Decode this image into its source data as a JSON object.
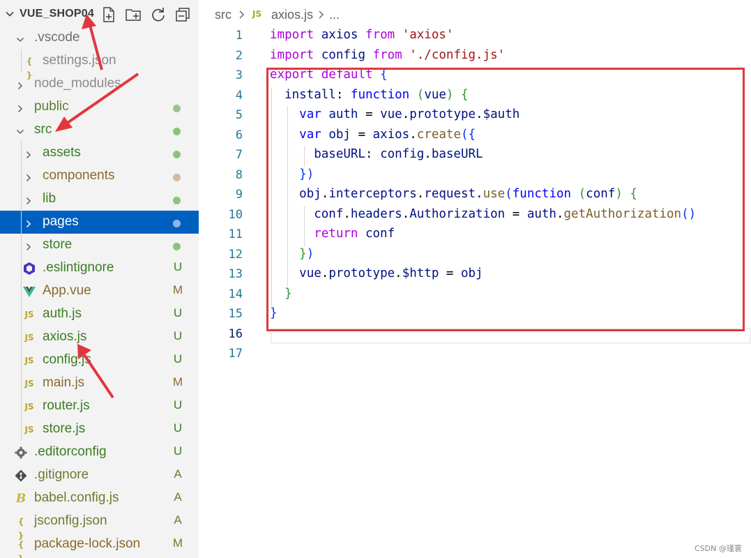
{
  "explorer": {
    "folder_name": "VUE_SHOP04",
    "actions": [
      "new-file-icon",
      "new-folder-icon",
      "refresh-icon",
      "collapse-all-icon"
    ],
    "items": [
      {
        "label": ".vscode",
        "kind": "folder",
        "expanded": true,
        "depth": 1,
        "color": "#6f6f6f",
        "status": "",
        "dot": ""
      },
      {
        "label": "settings.json",
        "kind": "json",
        "depth": 2,
        "color": "#8a8a8a",
        "status": "",
        "dot": ""
      },
      {
        "label": "node_modules",
        "kind": "folder",
        "expanded": false,
        "depth": 1,
        "color": "#8a8a8a",
        "status": "",
        "dot": ""
      },
      {
        "label": "public",
        "kind": "folder",
        "expanded": false,
        "depth": 1,
        "color": "#5a7f2c",
        "status": "",
        "dot": "#9cc38e"
      },
      {
        "label": "src",
        "kind": "folder",
        "expanded": true,
        "depth": 1,
        "color": "#3a7d22",
        "status": "",
        "dot": "#8cc27e"
      },
      {
        "label": "assets",
        "kind": "folder",
        "expanded": false,
        "depth": 2,
        "color": "#3a7d22",
        "status": "",
        "dot": "#8cc27e"
      },
      {
        "label": "components",
        "kind": "folder",
        "expanded": false,
        "depth": 2,
        "color": "#8a6a2c",
        "status": "",
        "dot": "#d5b99a"
      },
      {
        "label": "lib",
        "kind": "folder",
        "expanded": false,
        "depth": 2,
        "color": "#3a7d22",
        "status": "",
        "dot": "#8cc27e"
      },
      {
        "label": "pages",
        "kind": "folder",
        "expanded": false,
        "depth": 2,
        "color": "#ffffff",
        "status": "",
        "dot": "#8fb6e8",
        "selected": true
      },
      {
        "label": "store",
        "kind": "folder",
        "expanded": false,
        "depth": 2,
        "color": "#3a7d22",
        "status": "",
        "dot": "#8cc27e"
      },
      {
        "label": ".eslintignore",
        "kind": "eslint",
        "depth": 2,
        "color": "#3a7d22",
        "status": "U"
      },
      {
        "label": "App.vue",
        "kind": "vue",
        "depth": 2,
        "color": "#8a6a2c",
        "status": "M"
      },
      {
        "label": "auth.js",
        "kind": "js",
        "depth": 2,
        "color": "#3a7d22",
        "status": "U"
      },
      {
        "label": "axios.js",
        "kind": "js",
        "depth": 2,
        "color": "#3a7d22",
        "status": "U"
      },
      {
        "label": "config.js",
        "kind": "js",
        "depth": 2,
        "color": "#3a7d22",
        "status": "U"
      },
      {
        "label": "main.js",
        "kind": "js",
        "depth": 2,
        "color": "#8a6a2c",
        "status": "M"
      },
      {
        "label": "router.js",
        "kind": "js",
        "depth": 2,
        "color": "#3a7d22",
        "status": "U"
      },
      {
        "label": "store.js",
        "kind": "js",
        "depth": 2,
        "color": "#3a7d22",
        "status": "U"
      },
      {
        "label": ".editorconfig",
        "kind": "gear",
        "depth": 1,
        "color": "#3a7d22",
        "status": "U"
      },
      {
        "label": ".gitignore",
        "kind": "git",
        "depth": 1,
        "color": "#6f7a2c",
        "status": "A"
      },
      {
        "label": "babel.config.js",
        "kind": "babel",
        "depth": 1,
        "color": "#6f7a2c",
        "status": "A"
      },
      {
        "label": "jsconfig.json",
        "kind": "json",
        "depth": 1,
        "color": "#6f7a2c",
        "status": "A"
      },
      {
        "label": "package-lock.json",
        "kind": "json",
        "depth": 1,
        "color": "#8a6a2c",
        "status": "M"
      }
    ],
    "status_colors": {
      "U": "#3a7d22",
      "M": "#8a6a2c",
      "A": "#6f7a2c"
    }
  },
  "breadcrumb": {
    "folder": "src",
    "file_icon_label": "JS",
    "file": "axios.js",
    "more": "..."
  },
  "editor": {
    "active_line": 16,
    "lines": [
      {
        "n": "1",
        "tokens": [
          {
            "t": "import",
            "c": "kw"
          },
          {
            "t": " "
          },
          {
            "t": "axios",
            "c": "vr"
          },
          {
            "t": " "
          },
          {
            "t": "from",
            "c": "kw"
          },
          {
            "t": " "
          },
          {
            "t": "'axios'",
            "c": "st"
          }
        ]
      },
      {
        "n": "2",
        "tokens": [
          {
            "t": "import",
            "c": "kw"
          },
          {
            "t": " "
          },
          {
            "t": "config",
            "c": "vr"
          },
          {
            "t": " "
          },
          {
            "t": "from",
            "c": "kw"
          },
          {
            "t": " "
          },
          {
            "t": "'./config.js'",
            "c": "st"
          }
        ]
      },
      {
        "n": "3",
        "tokens": [
          {
            "t": "export",
            "c": "kw"
          },
          {
            "t": " "
          },
          {
            "t": "default",
            "c": "kw"
          },
          {
            "t": " "
          },
          {
            "t": "{",
            "c": "br1"
          }
        ]
      },
      {
        "n": "4",
        "tokens": [
          {
            "t": "  "
          },
          {
            "t": "install",
            "c": "vr"
          },
          {
            "t": ": "
          },
          {
            "t": "function",
            "c": "bl"
          },
          {
            "t": " "
          },
          {
            "t": "(",
            "c": "br2"
          },
          {
            "t": "vue",
            "c": "vr"
          },
          {
            "t": ")",
            "c": "br2"
          },
          {
            "t": " "
          },
          {
            "t": "{",
            "c": "br2"
          }
        ]
      },
      {
        "n": "5",
        "tokens": [
          {
            "t": "    "
          },
          {
            "t": "var",
            "c": "bl"
          },
          {
            "t": " "
          },
          {
            "t": "auth",
            "c": "vr"
          },
          {
            "t": " = "
          },
          {
            "t": "vue",
            "c": "vr"
          },
          {
            "t": "."
          },
          {
            "t": "prototype",
            "c": "vr"
          },
          {
            "t": "."
          },
          {
            "t": "$auth",
            "c": "vr"
          }
        ]
      },
      {
        "n": "6",
        "tokens": [
          {
            "t": "    "
          },
          {
            "t": "var",
            "c": "bl"
          },
          {
            "t": " "
          },
          {
            "t": "obj",
            "c": "vr"
          },
          {
            "t": " = "
          },
          {
            "t": "axios",
            "c": "vr"
          },
          {
            "t": "."
          },
          {
            "t": "create",
            "c": "fn"
          },
          {
            "t": "(",
            "c": "br1"
          },
          {
            "t": "{",
            "c": "br1"
          }
        ]
      },
      {
        "n": "7",
        "tokens": [
          {
            "t": "      "
          },
          {
            "t": "baseURL",
            "c": "vr"
          },
          {
            "t": ": "
          },
          {
            "t": "config",
            "c": "vr"
          },
          {
            "t": "."
          },
          {
            "t": "baseURL",
            "c": "vr"
          }
        ]
      },
      {
        "n": "8",
        "tokens": [
          {
            "t": "    "
          },
          {
            "t": "}",
            "c": "br1"
          },
          {
            "t": ")",
            "c": "br1"
          }
        ]
      },
      {
        "n": "9",
        "tokens": [
          {
            "t": "    "
          },
          {
            "t": "obj",
            "c": "vr"
          },
          {
            "t": "."
          },
          {
            "t": "interceptors",
            "c": "vr"
          },
          {
            "t": "."
          },
          {
            "t": "request",
            "c": "vr"
          },
          {
            "t": "."
          },
          {
            "t": "use",
            "c": "fn"
          },
          {
            "t": "(",
            "c": "br1"
          },
          {
            "t": "function",
            "c": "bl"
          },
          {
            "t": " "
          },
          {
            "t": "(",
            "c": "br2"
          },
          {
            "t": "conf",
            "c": "vr"
          },
          {
            "t": ")",
            "c": "br2"
          },
          {
            "t": " "
          },
          {
            "t": "{",
            "c": "br2"
          }
        ]
      },
      {
        "n": "10",
        "tokens": [
          {
            "t": "      "
          },
          {
            "t": "conf",
            "c": "vr"
          },
          {
            "t": "."
          },
          {
            "t": "headers",
            "c": "vr"
          },
          {
            "t": "."
          },
          {
            "t": "Authorization",
            "c": "vr"
          },
          {
            "t": " = "
          },
          {
            "t": "auth",
            "c": "vr"
          },
          {
            "t": "."
          },
          {
            "t": "getAuthorization",
            "c": "fn"
          },
          {
            "t": "()",
            "c": "br1"
          }
        ]
      },
      {
        "n": "11",
        "tokens": [
          {
            "t": "      "
          },
          {
            "t": "return",
            "c": "kw"
          },
          {
            "t": " "
          },
          {
            "t": "conf",
            "c": "vr"
          }
        ]
      },
      {
        "n": "12",
        "tokens": [
          {
            "t": "    "
          },
          {
            "t": "}",
            "c": "br2"
          },
          {
            "t": ")",
            "c": "br1"
          }
        ]
      },
      {
        "n": "13",
        "tokens": [
          {
            "t": "    "
          },
          {
            "t": "vue",
            "c": "vr"
          },
          {
            "t": "."
          },
          {
            "t": "prototype",
            "c": "vr"
          },
          {
            "t": "."
          },
          {
            "t": "$http",
            "c": "vr"
          },
          {
            "t": " = "
          },
          {
            "t": "obj",
            "c": "vr"
          }
        ]
      },
      {
        "n": "14",
        "tokens": [
          {
            "t": "  "
          },
          {
            "t": "}",
            "c": "br2"
          }
        ]
      },
      {
        "n": "15",
        "tokens": [
          {
            "t": "}",
            "c": "br1"
          }
        ]
      },
      {
        "n": "16",
        "tokens": []
      },
      {
        "n": "17",
        "tokens": []
      }
    ]
  },
  "watermark": "CSDN @瑾寰",
  "colors": {
    "selection": "#0060c0",
    "annotation": "#e0373f",
    "line_number": "#237893"
  }
}
